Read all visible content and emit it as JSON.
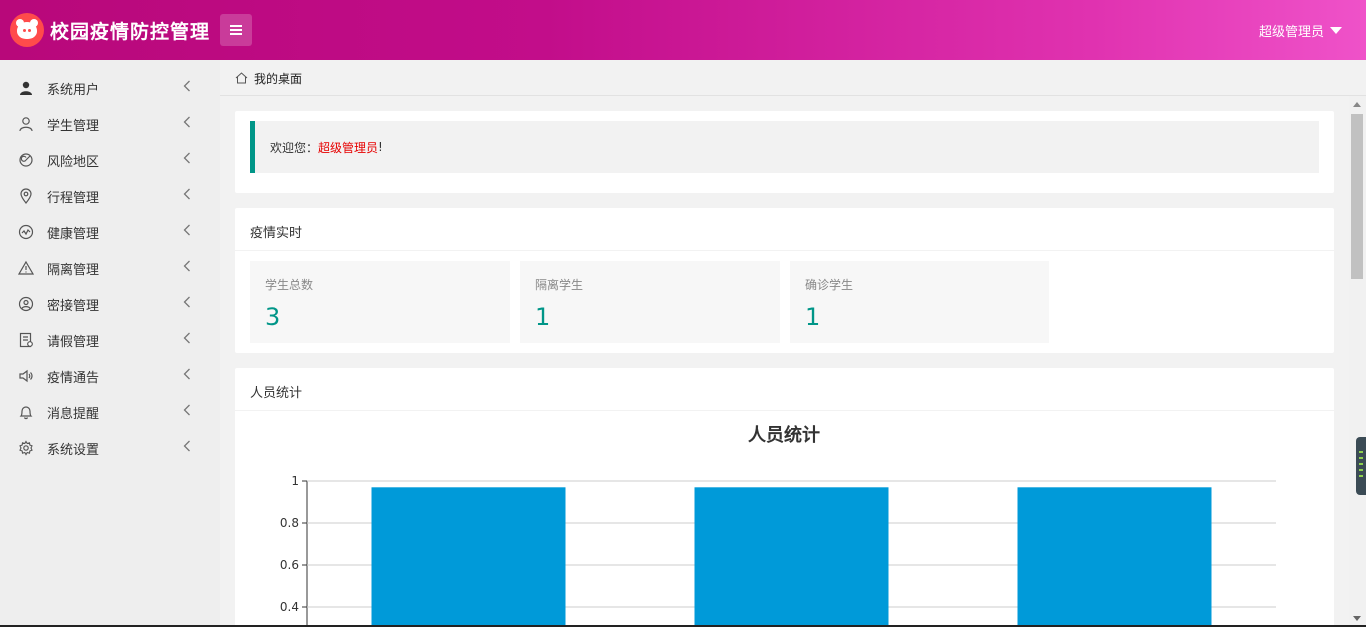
{
  "header": {
    "app_title": "校园疫情防控管理",
    "user_label": "超级管理员"
  },
  "sidebar": {
    "items": [
      {
        "label": "系统用户",
        "icon": "user-solid-icon"
      },
      {
        "label": "学生管理",
        "icon": "user-outline-icon"
      },
      {
        "label": "风险地区",
        "icon": "radar-icon"
      },
      {
        "label": "行程管理",
        "icon": "location-pin-icon"
      },
      {
        "label": "健康管理",
        "icon": "pulse-icon"
      },
      {
        "label": "隔离管理",
        "icon": "warning-icon"
      },
      {
        "label": "密接管理",
        "icon": "user-circle-icon"
      },
      {
        "label": "请假管理",
        "icon": "form-icon"
      },
      {
        "label": "疫情通告",
        "icon": "speaker-icon"
      },
      {
        "label": "消息提醒",
        "icon": "bell-icon"
      },
      {
        "label": "系统设置",
        "icon": "gear-icon"
      }
    ]
  },
  "breadcrumb": {
    "label": "我的桌面"
  },
  "welcome": {
    "prefix": "欢迎您：",
    "name": "超级管理员",
    "suffix": "!"
  },
  "realtime": {
    "title": "疫情实时",
    "stats": [
      {
        "label": "学生总数",
        "value": "3"
      },
      {
        "label": "隔离学生",
        "value": "1"
      },
      {
        "label": "确诊学生",
        "value": "1"
      }
    ]
  },
  "stats_card": {
    "title": "人员统计"
  },
  "colors": {
    "accent": "#009688",
    "bar": "#009ad9",
    "welcome_name": "#e60000"
  },
  "chart_data": {
    "type": "bar",
    "title": "人员统计",
    "categories": [
      "",
      "",
      ""
    ],
    "values": [
      1,
      1,
      1
    ],
    "ylim": [
      0,
      1
    ],
    "yticks": [
      "1",
      "0.8",
      "0.6",
      "0.4"
    ],
    "ytick_values": [
      1,
      0.8,
      0.6,
      0.4
    ],
    "grid": true
  }
}
